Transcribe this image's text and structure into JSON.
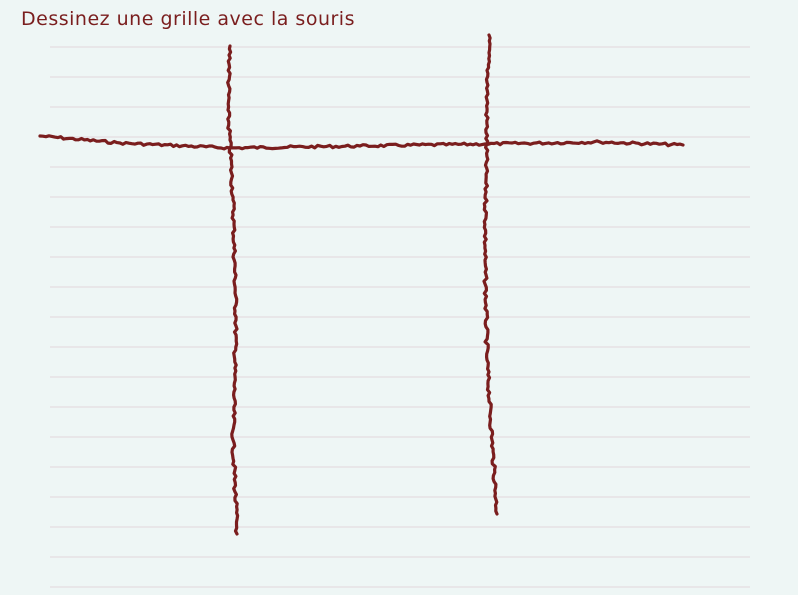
{
  "instruction": "Dessinez une grille avec la souris",
  "colors": {
    "background": "#eef6f5",
    "ruled_line": "#e3d6dc",
    "ink": "#7a1e1e"
  },
  "paper": {
    "ruled_line_count": 19
  },
  "drawing": {
    "stroke_count": 3,
    "strokes": [
      {
        "name": "stroke-horizontal"
      },
      {
        "name": "stroke-vertical-left"
      },
      {
        "name": "stroke-vertical-right"
      }
    ]
  }
}
